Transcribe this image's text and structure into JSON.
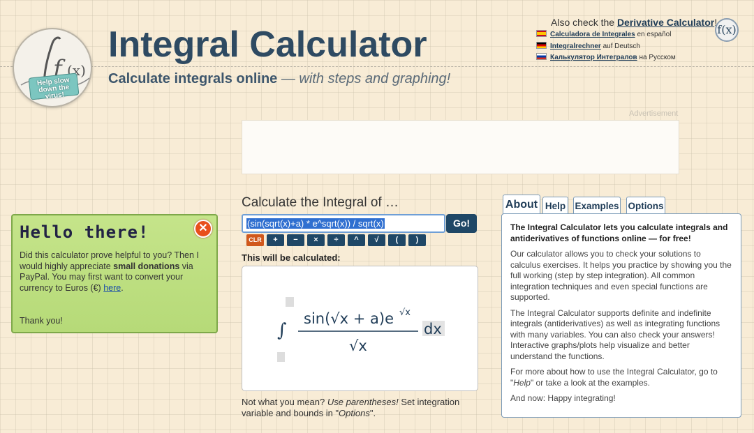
{
  "header": {
    "title": "Integral Calculator",
    "subtitle_bold": "Calculate integrals online",
    "subtitle_italic": " — with steps and graphing!",
    "logo_badge": "Help slow down the virus!",
    "also_check_prefix": "Also check the ",
    "also_check_link": "Derivative Calculator",
    "also_check_suffix": "!",
    "languages": [
      {
        "link": "Calculadora de Integrales",
        "suffix": " en español",
        "flag": "es"
      },
      {
        "link": "Integralrechner",
        "suffix": " auf Deutsch",
        "flag": "de"
      },
      {
        "link": "Калькулятор Интегралов",
        "suffix": " на Русском",
        "flag": "ru"
      }
    ],
    "fx_badge": "f(x)"
  },
  "ad": {
    "label": "Advertisement"
  },
  "donate": {
    "title": "Hello there!",
    "text_1": "Did this calculator prove helpful to you? Then I would highly appreciate ",
    "text_bold": "small donations",
    "text_2": " via PayPal. You may first want to convert your currency to Euros (€) ",
    "link": "here",
    "text_3": ".",
    "thanks": "Thank you!",
    "close_symbol": "✕"
  },
  "calculator": {
    "heading": "Calculate the Integral of …",
    "input_value": "(sin(sqrt(x)+a) * e^sqrt(x)) / sqrt(x)",
    "go_label": "Go!",
    "keys": [
      "CLR",
      "+",
      "−",
      "×",
      "÷",
      "^",
      "√",
      "(",
      ")"
    ],
    "will_calc_label": "This will be calculated:",
    "preview": {
      "integral_sign": "∫",
      "numerator": "sin(√x + a)e",
      "exponent": "√x",
      "denominator": "√x",
      "differential": "dx"
    },
    "hint_1": "Not what you mean? ",
    "hint_italic": "Use parentheses!",
    "hint_2": " Set integration variable and bounds in \"",
    "hint_italic_2": "Options",
    "hint_3": "\"."
  },
  "tabs": [
    "About",
    "Help",
    "Examples",
    "Options"
  ],
  "about": {
    "lead": "The Integral Calculator lets you calculate integrals and antiderivatives of functions online — for free!",
    "p1": "Our calculator allows you to check your solutions to calculus exercises. It helps you practice by showing you the full working (step by step integration). All common integration techniques and even special functions are supported.",
    "p2": "The Integral Calculator supports definite and indefinite integrals (antiderivatives) as well as integrating functions with many variables. You can also check your answers! Interactive graphs/plots help visualize and better understand the functions.",
    "p3_prefix": "For more about how to use the Integral Calculator, go to \"",
    "p3_italic": "Help",
    "p3_suffix": "\" or take a look at the examples.",
    "p4": "And now: Happy integrating!"
  }
}
